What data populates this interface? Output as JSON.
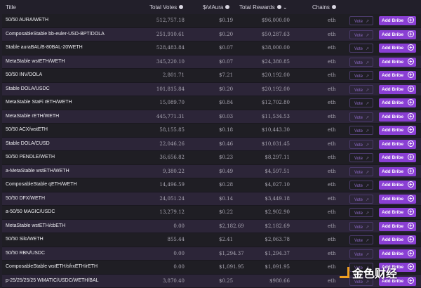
{
  "header": {
    "title": "Title",
    "votes": "Total Votes",
    "price": "$/vlAura",
    "rewards": "Total Rewards",
    "chains": "Chains"
  },
  "vote_label": "Vote",
  "bribe_label": "Add Bribe",
  "watermark": "金色财经",
  "rows": [
    {
      "title": "50/50 AURA/WETH",
      "votes": "512,757.18",
      "price": "$0.19",
      "rewards": "$96,000.00",
      "chain": "eth"
    },
    {
      "title": "ComposableStable bb-euler-USD-BPT/DOLA",
      "votes": "251,910.61",
      "price": "$0.20",
      "rewards": "$50,287.63",
      "chain": "eth"
    },
    {
      "title": "Stable auraBAL/B-80BAL-20WETH",
      "votes": "528,483.84",
      "price": "$0.07",
      "rewards": "$38,000.00",
      "chain": "eth"
    },
    {
      "title": "MetaStable wstETH/WETH",
      "votes": "345,220.10",
      "price": "$0.07",
      "rewards": "$24,380.85",
      "chain": "eth"
    },
    {
      "title": "50/50 INV/DOLA",
      "votes": "2,801.71",
      "price": "$7.21",
      "rewards": "$20,192.00",
      "chain": "eth"
    },
    {
      "title": "Stable DOLA/USDC",
      "votes": "101,815.84",
      "price": "$0.20",
      "rewards": "$20,192.00",
      "chain": "eth"
    },
    {
      "title": "MetaStable StaFi rETH/WETH",
      "votes": "15,089.70",
      "price": "$0.84",
      "rewards": "$12,702.80",
      "chain": "eth"
    },
    {
      "title": "MetaStable rETH/WETH",
      "votes": "445,771.31",
      "price": "$0.03",
      "rewards": "$11,534.53",
      "chain": "eth"
    },
    {
      "title": "50/50 ACX/wstETH",
      "votes": "58,155.85",
      "price": "$0.18",
      "rewards": "$10,443.30",
      "chain": "eth"
    },
    {
      "title": "Stable DOLA/CUSD",
      "votes": "22,046.26",
      "price": "$0.46",
      "rewards": "$10,031.45",
      "chain": "eth"
    },
    {
      "title": "50/50 PENDLE/WETH",
      "votes": "36,656.82",
      "price": "$0.23",
      "rewards": "$8,297.11",
      "chain": "eth"
    },
    {
      "title": "a-MetaStable wstETH/WETH",
      "votes": "9,380.22",
      "price": "$0.49",
      "rewards": "$4,597.51",
      "chain": "eth"
    },
    {
      "title": "ComposableStable qETH/WETH",
      "votes": "14,496.59",
      "price": "$0.28",
      "rewards": "$4,027.10",
      "chain": "eth"
    },
    {
      "title": "50/50 DFX/WETH",
      "votes": "24,051.24",
      "price": "$0.14",
      "rewards": "$3,449.18",
      "chain": "eth"
    },
    {
      "title": "a-50/50 MAGIC/USDC",
      "votes": "13,279.12",
      "price": "$0.22",
      "rewards": "$2,902.90",
      "chain": "eth"
    },
    {
      "title": "MetaStable wstETH/cbETH",
      "votes": "0.00",
      "price": "$2,182.69",
      "rewards": "$2,182.69",
      "chain": "eth"
    },
    {
      "title": "50/50 Silo/WETH",
      "votes": "855.44",
      "price": "$2.41",
      "rewards": "$2,063.78",
      "chain": "eth"
    },
    {
      "title": "50/50 RBN/USDC",
      "votes": "0.00",
      "price": "$1,294.37",
      "rewards": "$1,294.37",
      "chain": "eth"
    },
    {
      "title": "ComposableStable wstETH/sfrxETH/rETH",
      "votes": "0.00",
      "price": "$1,091.95",
      "rewards": "$1,091.95",
      "chain": "eth"
    },
    {
      "title": "p-25/25/25/25 WMATIC/USDC/WETH/BAL",
      "votes": "3,870.40",
      "price": "$0.25",
      "rewards": "$980.66",
      "chain": "eth"
    }
  ]
}
